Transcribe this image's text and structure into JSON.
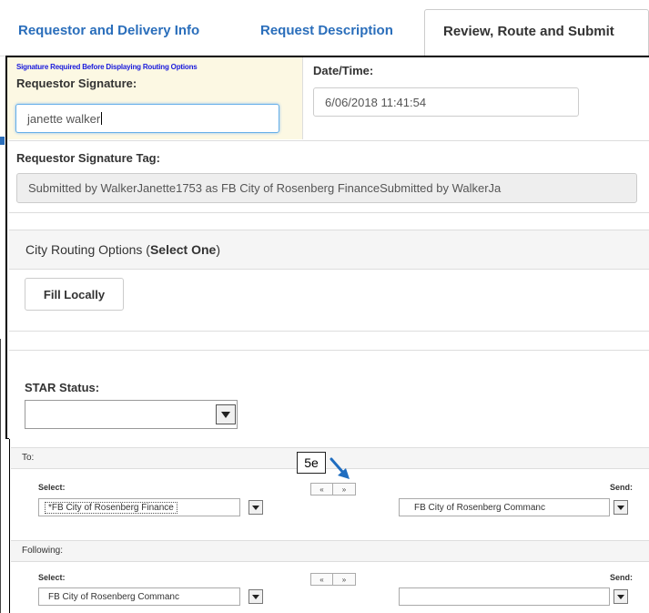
{
  "tabs": [
    {
      "label": "Requestor and Delivery Info"
    },
    {
      "label": "Request Description"
    },
    {
      "label": "Review, Route and Submit"
    }
  ],
  "signature": {
    "warning": "Signature Required Before Displaying Routing Options",
    "label": "Requestor Signature:",
    "value": "janette walker"
  },
  "datetime": {
    "label": "Date/Time:",
    "value": "6/06/2018 11:41:54"
  },
  "signature_tag": {
    "label": "Requestor Signature Tag:",
    "value": "Submitted by WalkerJanette1753 as FB City of Rosenberg FinanceSubmitted by WalkerJa"
  },
  "routing": {
    "title_prefix": "City Routing Options (",
    "title_bold": "Select One",
    "title_suffix": ")",
    "fill_locally_label": "Fill Locally"
  },
  "star_status": {
    "label": "STAR Status:",
    "value": ""
  },
  "to": {
    "header": "To:",
    "select_label": "Select:",
    "send_label": "Send:",
    "select_value": "*FB City of Rosenberg Finance",
    "send_value": "FB City of Rosenberg Commanc"
  },
  "following": {
    "header": "Following:",
    "select_label": "Select:",
    "send_label": "Send:",
    "select_value": "FB City of Rosenberg Commanc",
    "send_value": ""
  },
  "mover": {
    "left": "«",
    "right": "»"
  },
  "annotation": {
    "label": "5e",
    "color": "#1f6dc0"
  },
  "colors": {
    "tab_link": "#2a6ebb",
    "signature_bg": "#fcf8e3",
    "warning_text": "#1a1adc"
  }
}
